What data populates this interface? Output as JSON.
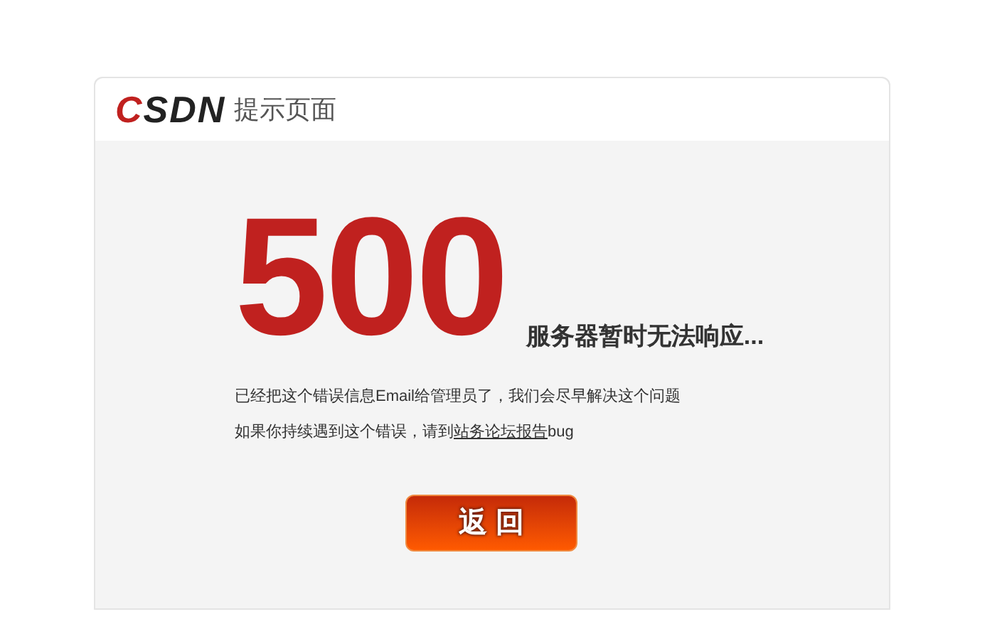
{
  "header": {
    "logo": "CSDN",
    "title": "提示页面"
  },
  "error": {
    "code": "500",
    "headline": "服务器暂时无法响应..."
  },
  "messages": [
    "已经把这个错误信息Email给管理员了，我们会尽早解决这个问题",
    {
      "before": "如果你持续遇到这个错误，请到",
      "link": "站务论坛报告",
      "after": "bug"
    }
  ],
  "button": {
    "label": "返 回"
  }
}
